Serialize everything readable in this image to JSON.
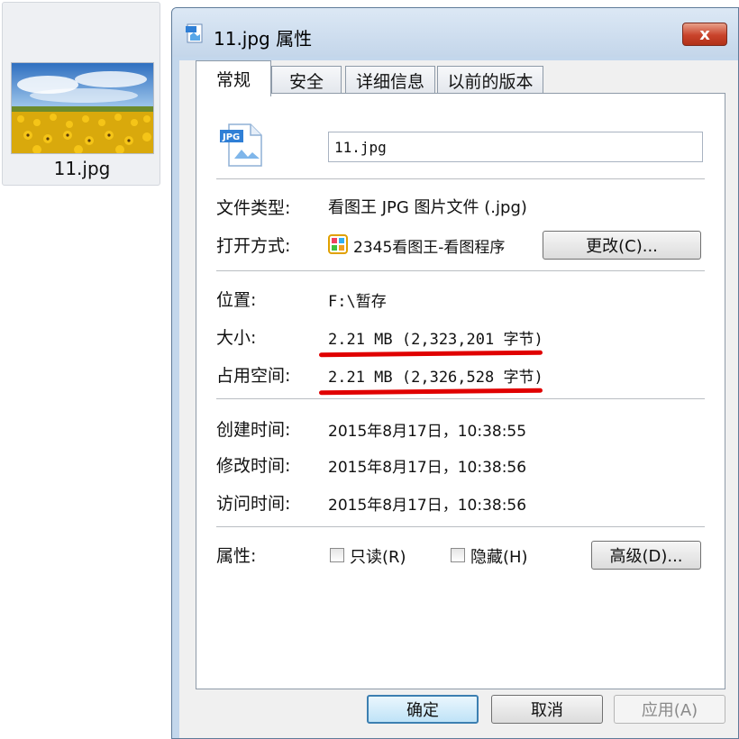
{
  "file_card": {
    "filename": "11.jpg",
    "thumbnail": "sunflower-field-icon"
  },
  "window": {
    "title": "11.jpg 属性",
    "title_icon": "image-file-icon",
    "close_label": "x"
  },
  "tabs": [
    {
      "label": "常规",
      "active": true
    },
    {
      "label": "安全",
      "active": false
    },
    {
      "label": "详细信息",
      "active": false
    },
    {
      "label": "以前的版本",
      "active": false
    }
  ],
  "general": {
    "file_icon": "jpg-file-icon",
    "name_value": "11.jpg",
    "file_type_label": "文件类型:",
    "file_type_value": "看图王 JPG 图片文件 (.jpg)",
    "open_with_label": "打开方式:",
    "open_with_value": "2345看图王-看图程序",
    "open_with_icon": "2345-viewer-icon",
    "change_button": "更改(C)...",
    "location_label": "位置:",
    "location_value": "F:\\暂存",
    "size_label": "大小:",
    "size_value": "2.21 MB (2,323,201 字节)",
    "size_on_disk_label": "占用空间:",
    "size_on_disk_value": "2.21 MB (2,326,528 字节)",
    "created_label": "创建时间:",
    "created_value": "2015年8月17日，10:38:55",
    "modified_label": "修改时间:",
    "modified_value": "2015年8月17日，10:38:56",
    "accessed_label": "访问时间:",
    "accessed_value": "2015年8月17日，10:38:56",
    "attributes_label": "属性:",
    "readonly_label": "只读(R)",
    "readonly_checked": false,
    "hidden_label": "隐藏(H)",
    "hidden_checked": false,
    "advanced_button": "高级(D)..."
  },
  "footer": {
    "ok_label": "确定",
    "cancel_label": "取消",
    "apply_label": "应用(A)"
  },
  "colors": {
    "annotation_red": "#e00000",
    "title_bar": "#c4d6ea",
    "close_button": "#c9432b"
  }
}
